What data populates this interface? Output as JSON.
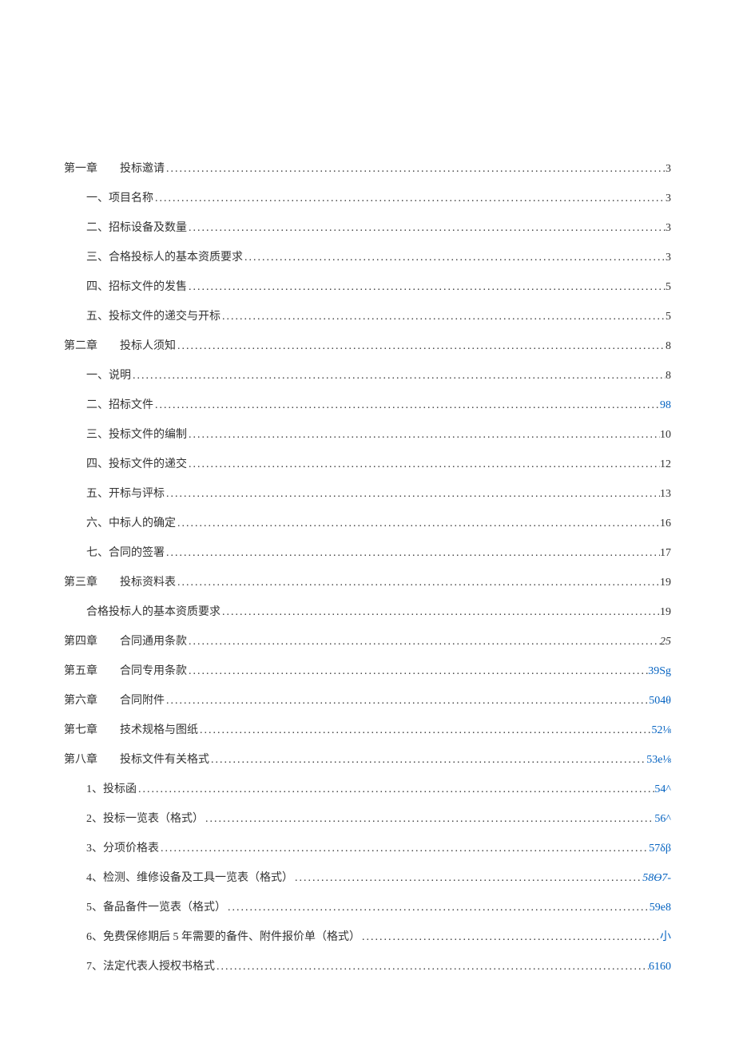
{
  "toc": [
    {
      "level": 0,
      "label": "第一章",
      "spacer": "　　",
      "title": "投标邀请",
      "page": "3",
      "pageClass": ""
    },
    {
      "level": 1,
      "label": "",
      "spacer": "",
      "title": "一、项目名称",
      "page": "3",
      "pageClass": ""
    },
    {
      "level": 1,
      "label": "",
      "spacer": "",
      "title": "二、招标设备及数量",
      "page": "3",
      "pageClass": ""
    },
    {
      "level": 1,
      "label": "",
      "spacer": "",
      "title": "三、合格投标人的基本资质要求",
      "page": "3",
      "pageClass": ""
    },
    {
      "level": 1,
      "label": "",
      "spacer": "",
      "title": "四、招标文件的发售",
      "page": "5",
      "pageClass": ""
    },
    {
      "level": 1,
      "label": "",
      "spacer": "",
      "title": "五、投标文件的递交与开标",
      "page": "5",
      "pageClass": ""
    },
    {
      "level": 0,
      "label": "第二章",
      "spacer": "　　",
      "title": "投标人须知",
      "page": "8",
      "pageClass": ""
    },
    {
      "level": 1,
      "label": "",
      "spacer": "",
      "title": "一、说明",
      "page": "8",
      "pageClass": ""
    },
    {
      "level": 1,
      "label": "",
      "spacer": "",
      "title": "二、招标文件",
      "page": "98",
      "pageClass": "blue-link"
    },
    {
      "level": 1,
      "label": "",
      "spacer": "",
      "title": "三、投标文件的编制",
      "page": "10",
      "pageClass": ""
    },
    {
      "level": 1,
      "label": "",
      "spacer": "",
      "title": "四、投标文件的递交",
      "page": "12",
      "pageClass": ""
    },
    {
      "level": 1,
      "label": "",
      "spacer": "",
      "title": "五、开标与评标",
      "page": "13",
      "pageClass": ""
    },
    {
      "level": 1,
      "label": "",
      "spacer": "",
      "title": "六、中标人的确定",
      "page": "16",
      "pageClass": ""
    },
    {
      "level": 1,
      "label": "",
      "spacer": "",
      "title": "七、合同的签署",
      "page": "17",
      "pageClass": ""
    },
    {
      "level": 0,
      "label": "第三章",
      "spacer": "　　",
      "title": "投标资料表",
      "page": "19",
      "pageClass": ""
    },
    {
      "level": 1,
      "label": "",
      "spacer": "",
      "title": "合格投标人的基本资质要求",
      "page": "19",
      "pageClass": ""
    },
    {
      "level": 0,
      "label": "第四章",
      "spacer": "　　",
      "title": "合同通用条款",
      "page": "25",
      "pageClass": "italic"
    },
    {
      "level": 0,
      "label": "第五章",
      "spacer": "　　",
      "title": "合同专用条款",
      "page": "39Sg",
      "pageClass": "blue-link"
    },
    {
      "level": 0,
      "label": "第六章",
      "spacer": "　　",
      "title": "合同附件",
      "page": "504θ",
      "pageClass": "blue-link"
    },
    {
      "level": 0,
      "label": "第七章",
      "spacer": "　　",
      "title": "技术规格与图纸",
      "page": "52⅛",
      "pageClass": "blue-link"
    },
    {
      "level": 0,
      "label": "第八章",
      "spacer": "　　",
      "title": "投标文件有关格式",
      "page": "53e⅛",
      "pageClass": "blue-link"
    },
    {
      "level": 1,
      "label": "",
      "spacer": "",
      "title": "1、投标函",
      "page": "54^",
      "pageClass": "blue-link"
    },
    {
      "level": 1,
      "label": "",
      "spacer": "",
      "title": "2、投标一览表（格式）",
      "page": "56^",
      "pageClass": "blue-link"
    },
    {
      "level": 1,
      "label": "",
      "spacer": "",
      "title": "3、分项价格表",
      "page": "57δβ",
      "pageClass": "blue-link"
    },
    {
      "level": 1,
      "label": "",
      "spacer": "",
      "title": "4、检测、维修设备及工具一览表（格式）",
      "page": "58Ө7-",
      "pageClass": "blue-link italic"
    },
    {
      "level": 1,
      "label": "",
      "spacer": "",
      "title": "5、备品备件一览表（格式）",
      "page": "59e8",
      "pageClass": "blue-link"
    },
    {
      "level": 1,
      "label": "",
      "spacer": "",
      "title": "6、免费保修期后 5 年需要的备件、附件报价单（格式）",
      "page": "小",
      "pageClass": "blue-link"
    },
    {
      "level": 1,
      "label": "",
      "spacer": "",
      "title": "7、法定代表人授权书格式",
      "page": "6160",
      "pageClass": "blue-link"
    }
  ]
}
